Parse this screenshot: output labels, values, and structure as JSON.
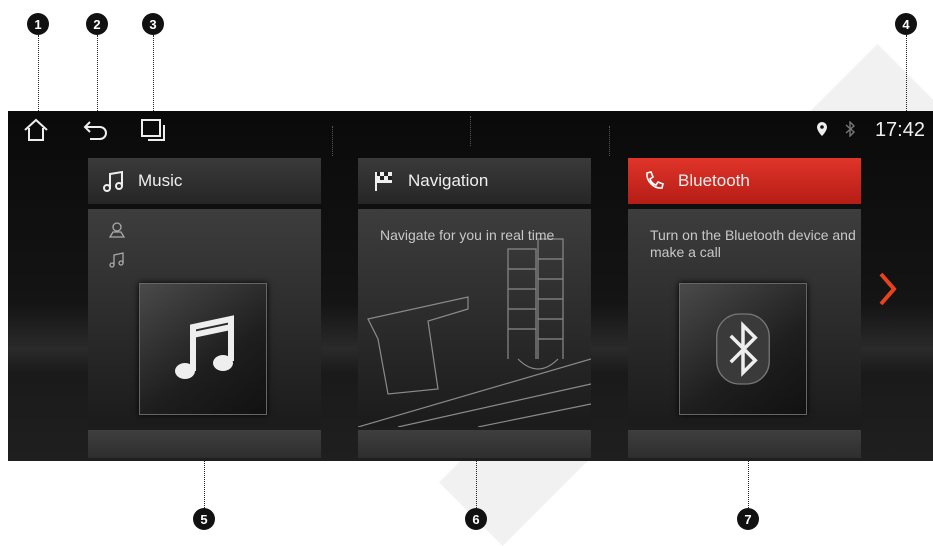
{
  "callouts": [
    "1",
    "2",
    "3",
    "4",
    "5",
    "6",
    "7"
  ],
  "status": {
    "time": "17:42",
    "icons": [
      "location-icon",
      "bluetooth-status-icon"
    ]
  },
  "nav_buttons": [
    "home-icon",
    "back-icon",
    "recent-apps-icon"
  ],
  "cards": [
    {
      "title": "Music",
      "icon": "music-note-icon",
      "description": "",
      "tile_icon": "music-note-icon",
      "active": false
    },
    {
      "title": "Navigation",
      "icon": "checkered-flag-icon",
      "description": "Navigate for you in real time",
      "active": false
    },
    {
      "title": "Bluetooth",
      "icon": "phone-icon",
      "description": "Turn on the Bluetooth device and make a call",
      "tile_icon": "bluetooth-icon",
      "active": true
    }
  ],
  "colors": {
    "accent": "#c8221a",
    "next_arrow": "#e8431c",
    "text": "#eeeeee"
  }
}
